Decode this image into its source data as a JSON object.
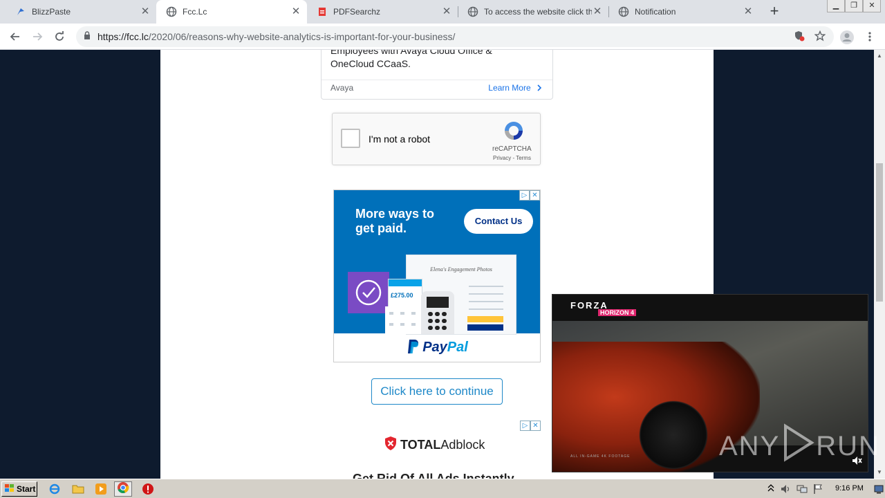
{
  "browser": {
    "tabs": [
      {
        "title": "BlizzPaste",
        "active": false
      },
      {
        "title": "Fcc.Lc",
        "active": true
      },
      {
        "title": "PDFSearchz",
        "active": false
      },
      {
        "title": "To access the website click the '",
        "active": false
      },
      {
        "title": "Notification",
        "active": false
      }
    ],
    "url_host": "https://fcc.lc",
    "url_path": "/2020/06/reasons-why-website-analytics-is-important-for-your-business/"
  },
  "page": {
    "ad_card": {
      "headline": "Employees with Avaya Cloud Office & OneCloud CCaaS.",
      "brand": "Avaya",
      "cta": "Learn More"
    },
    "recaptcha": {
      "label": "I'm not a robot",
      "brand": "reCAPTCHA",
      "links": "Privacy - Terms"
    },
    "paypal_ad": {
      "headline": "More ways to get paid.",
      "cta": "Contact Us",
      "mock_title": "Elena's Engagement Photos",
      "price": "£275.00",
      "logo_pay": "Pay",
      "logo_pal": "Pal"
    },
    "continue_button": "Click here to continue",
    "total_adblock": {
      "brand_bold": "TOTAL",
      "brand_rest": "Adblock"
    },
    "cutoff_text": "Get Rid Of All Ads Instantly"
  },
  "video": {
    "brand_top": "FORZA",
    "brand_sub": "HORIZON 4",
    "footer": "ALL IN-GAME 4K FOOTAGE"
  },
  "watermark": {
    "left": "ANY",
    "right": "RUN"
  },
  "taskbar": {
    "start_label": "Start",
    "clock": "9:16 PM"
  },
  "colors": {
    "page_bg": "#0e1b2e",
    "link_blue": "#1a73e8",
    "paypal_blue": "#0070ba",
    "paypal_dark": "#003087"
  }
}
